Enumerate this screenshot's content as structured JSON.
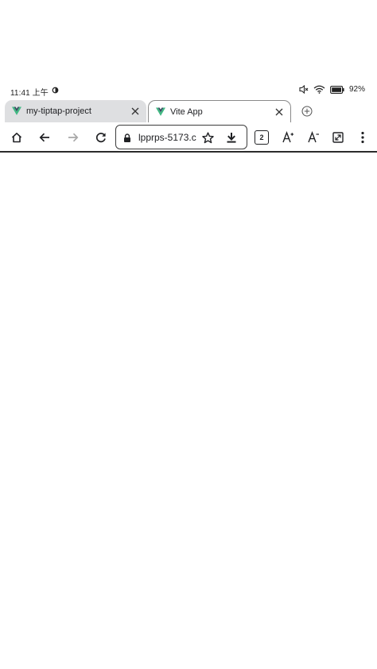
{
  "status_bar": {
    "time": "11:41 上午",
    "battery": "92%"
  },
  "tabs": [
    {
      "title": "my-tiptap-project",
      "active": false,
      "favicon": "vue-logo-icon"
    },
    {
      "title": "Vite App",
      "active": true,
      "favicon": "vue-logo-icon"
    }
  ],
  "toolbar": {
    "url": "lpprps-5173.c",
    "tab_count": "2"
  },
  "colors": {
    "vue_green": "#41b883",
    "vue_dark": "#34495e",
    "inactive_tab_bg": "#dedfe1",
    "toolbar_border": "#2b2b2b"
  }
}
